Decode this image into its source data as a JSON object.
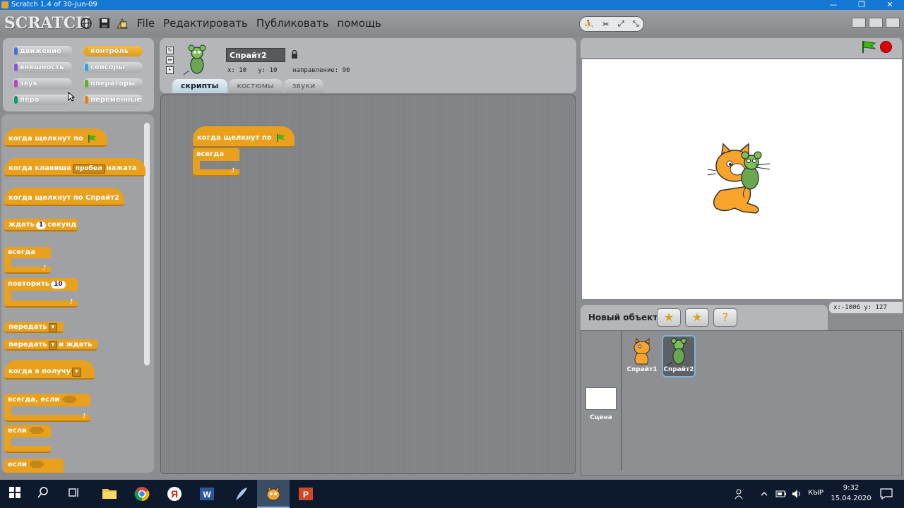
{
  "window": {
    "title": "Scratch 1.4 of 30-Jun-09",
    "controls": [
      "—",
      "❐",
      "✕"
    ]
  },
  "menubar": {
    "logo": "SCRATCH",
    "items": [
      "File",
      "Редактировать",
      "Публиковать",
      "помощь"
    ]
  },
  "categories": [
    {
      "label": "движение",
      "color": "#4a6cd4"
    },
    {
      "label": "контроль",
      "color": "#e1a91a"
    },
    {
      "label": "внешность",
      "color": "#8a55d7"
    },
    {
      "label": "сенсоры",
      "color": "#2ca5e2"
    },
    {
      "label": "звук",
      "color": "#bb42c3"
    },
    {
      "label": "операторы",
      "color": "#5cb712"
    },
    {
      "label": "перо",
      "color": "#0e9a6c"
    },
    {
      "label": "переменные",
      "color": "#ee7d16"
    }
  ],
  "palette_blocks": {
    "when_flag": "когда щелкнут по",
    "when_key": "когда клавиша",
    "key_option": "пробел",
    "when_key_suffix": "нажата",
    "when_clicked_sprite": "когда щелкнут по  Спрайт2",
    "wait": "ждать",
    "wait_value": "1",
    "wait_unit": "секунд",
    "forever": "всегда",
    "repeat": "повторить",
    "repeat_value": "10",
    "broadcast": "передать",
    "broadcast_wait": "передать",
    "broadcast_wait_suffix": "и ждать",
    "when_receive": "когда я получу",
    "forever_if": "всегда, если",
    "if1": "если",
    "if2": "если"
  },
  "sprite": {
    "name": "Спрайт2",
    "x_label": "x:",
    "x": "10",
    "y_label": "y:",
    "y": "10",
    "direction_label": "направление:",
    "direction": "90"
  },
  "tabs": [
    {
      "label": "скрипты",
      "active": true
    },
    {
      "label": "костюмы",
      "active": false
    },
    {
      "label": "звуки",
      "active": false
    }
  ],
  "script": {
    "hat": "когда щелкнут по",
    "forever": "всегда"
  },
  "stage": {
    "mouse_x_label": "x:",
    "mouse_x": "-1006",
    "mouse_y_label": "y:",
    "mouse_y": "127"
  },
  "new_object": {
    "label": "Новый объект"
  },
  "sprites": [
    {
      "name": "Спрайт1",
      "selected": false
    },
    {
      "name": "Спрайт2",
      "selected": true
    }
  ],
  "scene": {
    "label": "Сцена"
  },
  "taskbar": {
    "lang": "КЫР",
    "time": "9:32",
    "date": "15.04.2020"
  }
}
